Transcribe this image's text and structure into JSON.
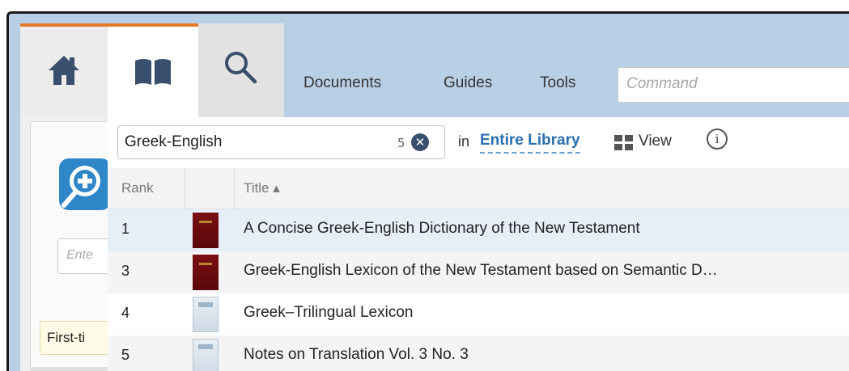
{
  "toolbar": {
    "home_icon": "home-icon",
    "library_icon": "book-icon",
    "search_icon": "search-icon",
    "menu": [
      "Documents",
      "Guides",
      "Tools"
    ],
    "command_placeholder": "Command"
  },
  "left_panel": {
    "input_placeholder": "Ente",
    "first_label": "First-ti"
  },
  "library": {
    "query": "Greek-English",
    "result_count": "5",
    "clear_icon": "clear-icon",
    "scope_prefix": "in",
    "scope_value": "Entire Library",
    "view_label": "View",
    "info_icon": "i",
    "columns": {
      "rank": "Rank",
      "title": "Title ▴"
    },
    "rows": [
      {
        "rank": "1",
        "title": "A Concise Greek-English Dictionary of the New Testament",
        "cover": "red",
        "highlighted": true
      },
      {
        "rank": "3",
        "title": "Greek-English Lexicon of the New Testament based on Semantic D…",
        "cover": "red",
        "highlighted": false
      },
      {
        "rank": "4",
        "title": "Greek–Trilingual Lexicon",
        "cover": "pale",
        "highlighted": false
      },
      {
        "rank": "5",
        "title": "Notes on Translation Vol. 3 No. 3",
        "cover": "pale",
        "highlighted": false
      }
    ]
  },
  "colors": {
    "accent": "#e8792b",
    "toolbar_bg": "#b9cfe6",
    "link": "#2a6fb0",
    "highlight_row": "#e6eef8",
    "alt_row": "#f4f4f4"
  }
}
